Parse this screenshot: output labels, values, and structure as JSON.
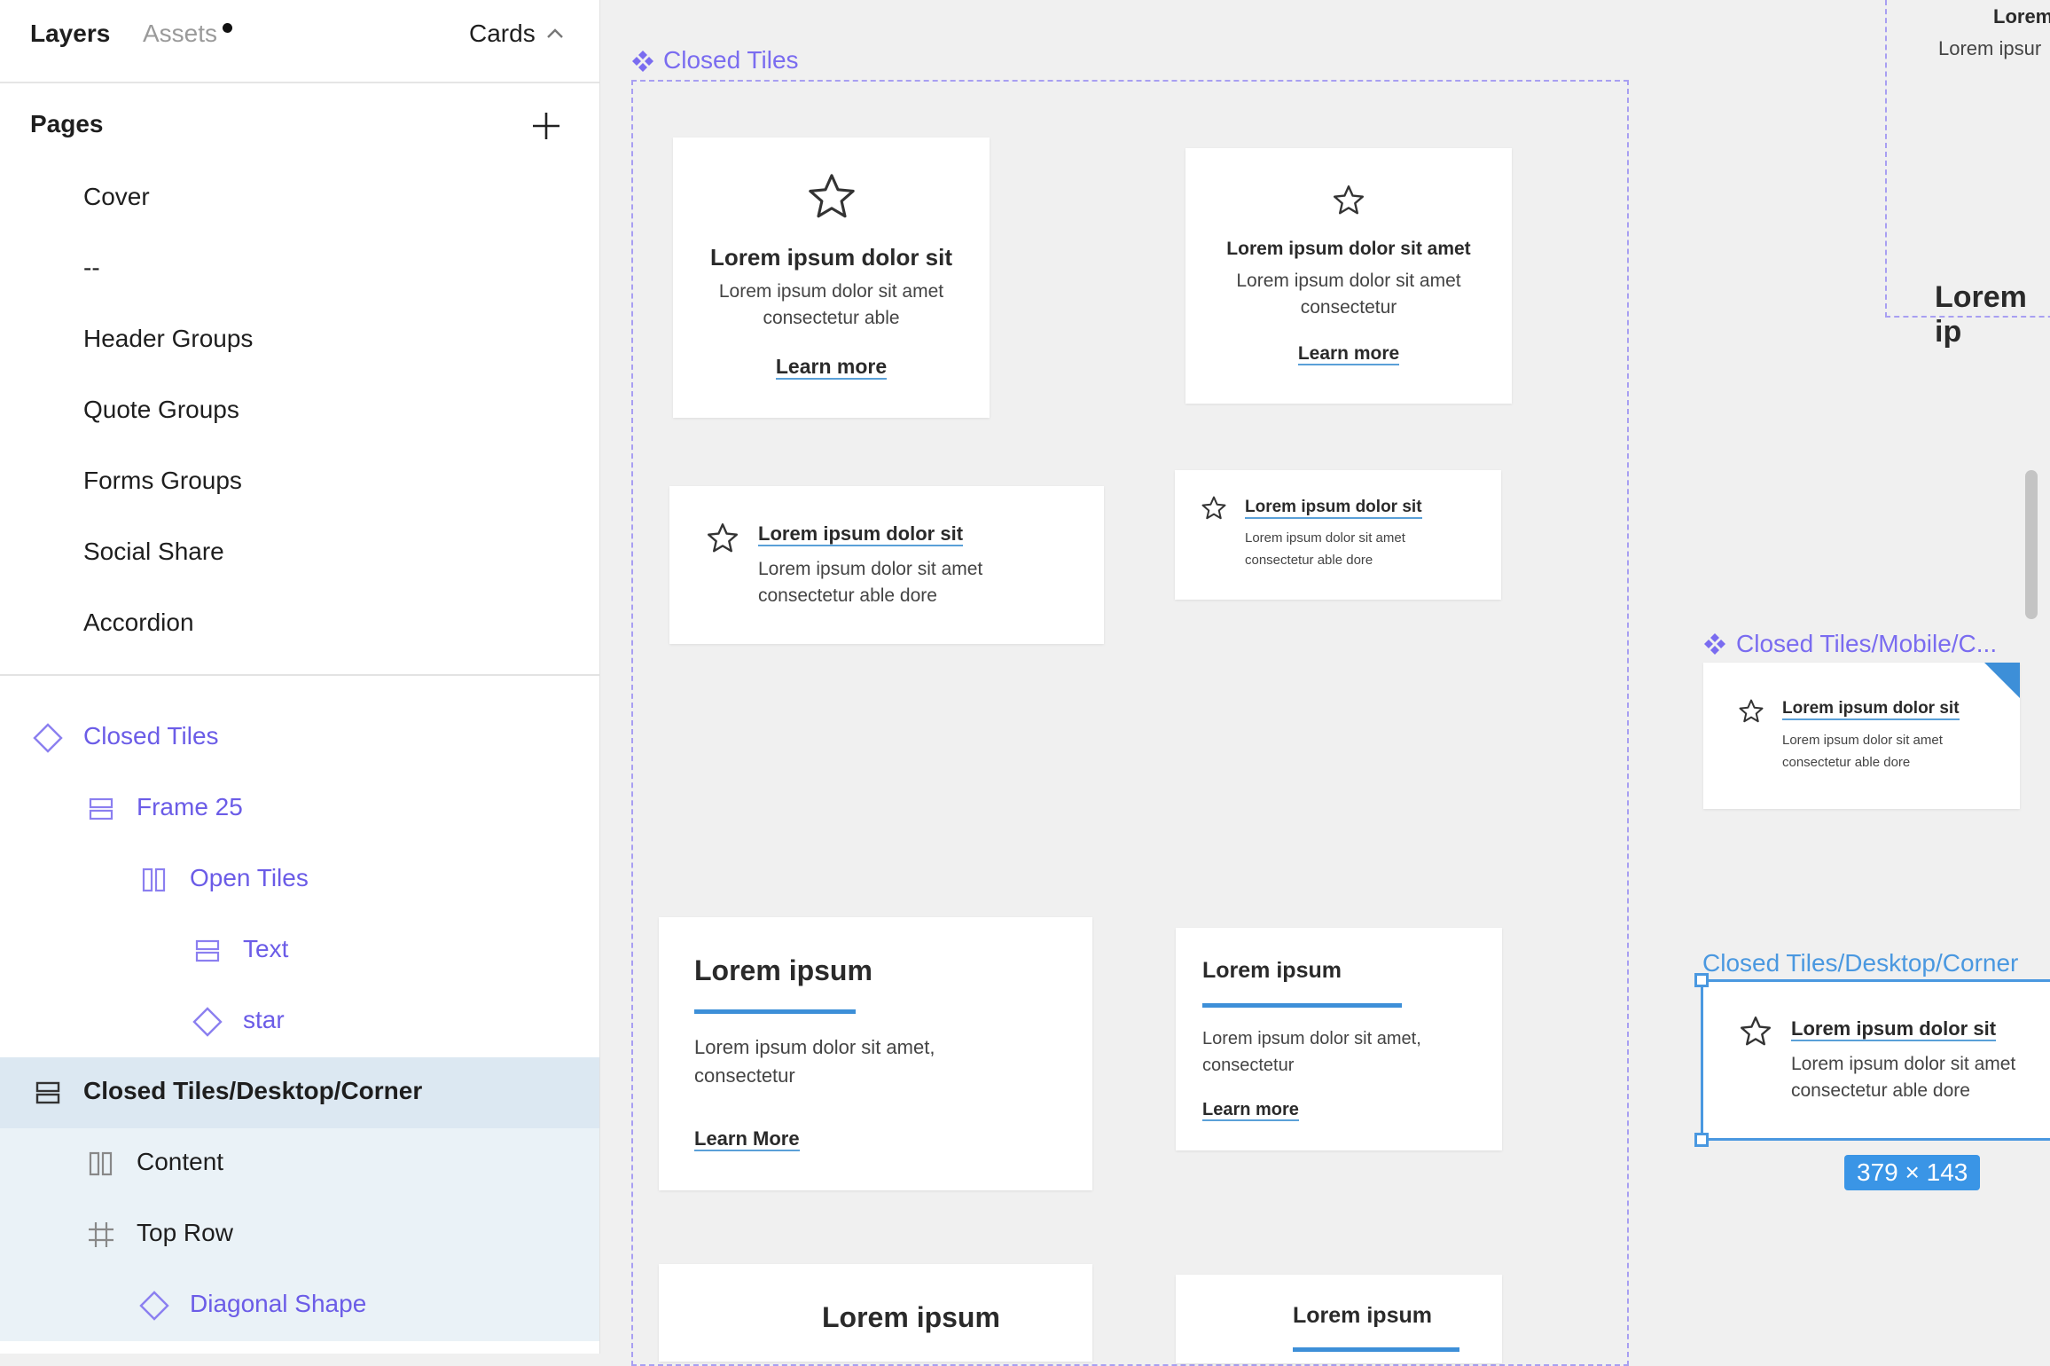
{
  "panel": {
    "tabs": {
      "layers": "Layers",
      "assets": "Assets"
    },
    "current_page": "Cards",
    "pages_title": "Pages",
    "pages": [
      "Cover",
      "--",
      "Header Groups",
      "Quote Groups",
      "Forms Groups",
      "Social Share",
      "Accordion"
    ],
    "layers": [
      {
        "label": "Closed Tiles",
        "icon": "component-icon"
      },
      {
        "label": "Frame 25",
        "icon": "vertical-autolayout-icon"
      },
      {
        "label": "Open Tiles",
        "icon": "horizontal-autolayout-icon"
      },
      {
        "label": "Text",
        "icon": "vertical-autolayout-icon"
      },
      {
        "label": "star",
        "icon": "component-instance-icon"
      },
      {
        "label": "Closed Tiles/Desktop/Corner",
        "icon": "vertical-autolayout-icon"
      },
      {
        "label": "Content",
        "icon": "horizontal-autolayout-icon"
      },
      {
        "label": "Top Row",
        "icon": "frame-icon"
      },
      {
        "label": "Diagonal Shape",
        "icon": "component-instance-icon"
      }
    ]
  },
  "canvas": {
    "frame_closed_tiles": "Closed Tiles",
    "frame_mobile": "Closed Tiles/Mobile/C...",
    "frame_desktop_corner": "Closed Tiles/Desktop/Corner",
    "dimension_badge": "379 × 143",
    "partial_top_right": {
      "title": "Lorem",
      "body": "Lorem ipsur",
      "heading": "Lorem ip"
    },
    "cards": {
      "c1": {
        "title": "Lorem ipsum dolor sit",
        "body1": "Lorem ipsum dolor sit amet",
        "body2": "consectetur able",
        "link": "Learn more"
      },
      "c2": {
        "title": "Lorem ipsum dolor sit amet",
        "body1": "Lorem ipsum dolor sit amet",
        "body2": "consectetur",
        "link": "Learn more"
      },
      "c3": {
        "title": "Lorem ipsum dolor sit",
        "body1": "Lorem ipsum dolor sit amet",
        "body2": "consectetur able dore"
      },
      "c4": {
        "title": "Lorem ipsum dolor sit",
        "body1": "Lorem ipsum dolor sit amet",
        "body2": "consectetur able dore"
      },
      "c5": {
        "title": "Lorem ipsum",
        "body1": "Lorem ipsum dolor sit amet,",
        "body2": "consectetur",
        "link": "Learn More"
      },
      "c6": {
        "title": "Lorem ipsum",
        "body1": "Lorem ipsum dolor sit amet,",
        "body2": "consectetur",
        "link": "Learn more"
      },
      "c7": {
        "title": "Lorem ipsum"
      },
      "c8": {
        "title": "Lorem ipsum"
      },
      "mobile": {
        "title": "Lorem ipsum dolor sit",
        "body1": "Lorem ipsum dolor sit amet",
        "body2": "consectetur able dore"
      },
      "desktop": {
        "title": "Lorem ipsum dolor sit",
        "body1": "Lorem ipsum dolor sit amet",
        "body2": "consectetur able dore"
      }
    }
  },
  "colors": {
    "accent_purple": "#7a6cf0",
    "selection_blue": "#4a98e0",
    "link_underline": "#5aa0d8",
    "corner_triangle": "#3d8fd8"
  }
}
